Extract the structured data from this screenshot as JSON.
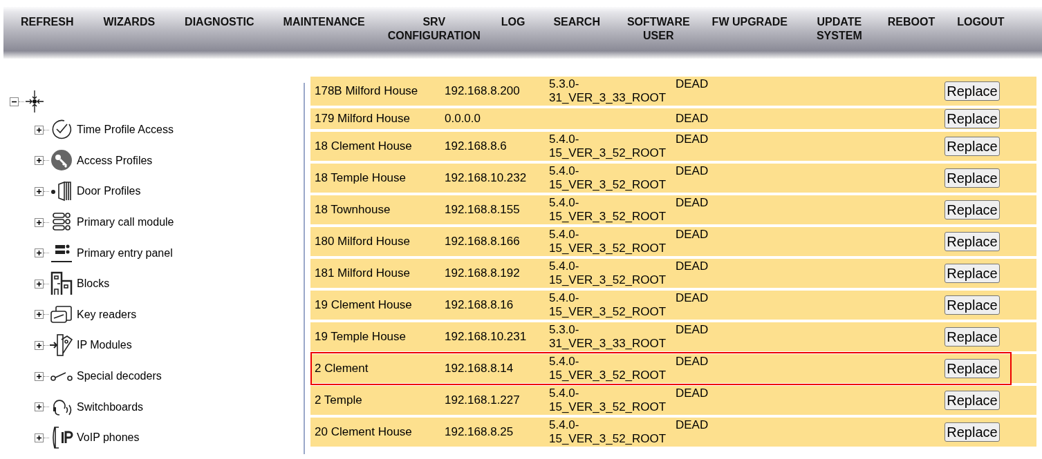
{
  "nav": [
    {
      "label": "REFRESH"
    },
    {
      "label": "WIZARDS"
    },
    {
      "label": "DIAGNOSTIC"
    },
    {
      "label": "MAINTENANCE"
    },
    {
      "label": "SRV\nCONFIGURATION"
    },
    {
      "label": "LOG"
    },
    {
      "label": "SEARCH"
    },
    {
      "label": "SOFTWARE\nUSER"
    },
    {
      "label": "FW UPGRADE"
    },
    {
      "label": "UPDATE\nSYSTEM"
    },
    {
      "label": "REBOOT"
    },
    {
      "label": "LOGOUT"
    }
  ],
  "tree": {
    "expanded": true,
    "children": [
      {
        "label": "Time Profile Access",
        "expanded": false
      },
      {
        "label": "Access Profiles",
        "expanded": false
      },
      {
        "label": "Door Profiles",
        "expanded": false
      },
      {
        "label": "Primary call module",
        "expanded": false
      },
      {
        "label": "Primary entry panel",
        "expanded": false
      },
      {
        "label": "Blocks",
        "expanded": false
      },
      {
        "label": "Key readers",
        "expanded": false
      },
      {
        "label": "IP Modules",
        "expanded": false
      },
      {
        "label": "Special decoders",
        "expanded": false
      },
      {
        "label": "Switchboards",
        "expanded": false
      },
      {
        "label": "VoIP phones",
        "expanded": false
      }
    ]
  },
  "table": {
    "rows": [
      {
        "name": "178B Milford House",
        "ip": "192.168.8.200",
        "version": "5.3.0-31_VER_3_33_ROOT",
        "status": "DEAD",
        "action": "Replace",
        "selected": false
      },
      {
        "name": "179 Milford House",
        "ip": "0.0.0.0",
        "status": "DEAD",
        "action": "Replace",
        "selected": false
      },
      {
        "name": "18 Clement House",
        "ip": "192.168.8.6",
        "version": "5.4.0-15_VER_3_52_ROOT",
        "status": "DEAD",
        "action": "Replace",
        "selected": false
      },
      {
        "name": "18 Temple House",
        "ip": "192.168.10.232",
        "version": "5.4.0-15_VER_3_52_ROOT",
        "status": "DEAD",
        "action": "Replace",
        "selected": false
      },
      {
        "name": "18 Townhouse",
        "ip": "192.168.8.155",
        "version": "5.4.0-15_VER_3_52_ROOT",
        "status": "DEAD",
        "action": "Replace",
        "selected": false
      },
      {
        "name": "180 Milford House",
        "ip": "192.168.8.166",
        "version": "5.4.0-15_VER_3_52_ROOT",
        "status": "DEAD",
        "action": "Replace",
        "selected": false
      },
      {
        "name": "181 Milford House",
        "ip": "192.168.8.192",
        "version": "5.4.0-15_VER_3_52_ROOT",
        "status": "DEAD",
        "action": "Replace",
        "selected": false
      },
      {
        "name": "19 Clement House",
        "ip": "192.168.8.16",
        "version": "5.4.0-15_VER_3_52_ROOT",
        "status": "DEAD",
        "action": "Replace",
        "selected": false
      },
      {
        "name": "19 Temple House",
        "ip": "192.168.10.231",
        "version": "5.3.0-31_VER_3_33_ROOT",
        "status": "DEAD",
        "action": "Replace",
        "selected": false
      },
      {
        "name": "2 Clement",
        "ip": "192.168.8.14",
        "version": "5.4.0-15_VER_3_52_ROOT",
        "status": "DEAD",
        "action": "Replace",
        "selected": true
      },
      {
        "name": "2 Temple",
        "ip": "192.168.1.227",
        "version": "5.4.0-15_VER_3_52_ROOT",
        "status": "DEAD",
        "action": "Replace",
        "selected": false
      },
      {
        "name": "20 Clement House",
        "ip": "192.168.8.25",
        "version": "5.4.0-15_VER_3_52_ROOT",
        "status": "DEAD",
        "action": "Replace",
        "selected": false
      }
    ]
  }
}
